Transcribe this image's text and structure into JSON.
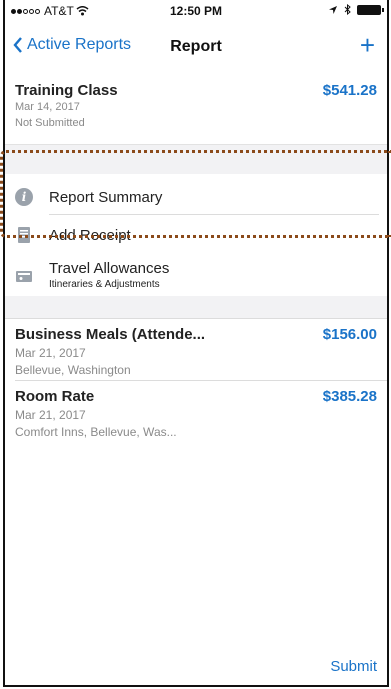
{
  "status_bar": {
    "carrier": "AT&T",
    "time": "12:50 PM"
  },
  "nav": {
    "back_label": "Active Reports",
    "title": "Report",
    "add_label": "+"
  },
  "report": {
    "name": "Training Class",
    "date": "Mar 14, 2017",
    "status": "Not Submitted",
    "amount": "$541.28"
  },
  "menu": {
    "items": [
      {
        "label": "Report Summary"
      },
      {
        "label": "Add Receipt"
      },
      {
        "label": "Travel Allowances",
        "sublabel": "Itineraries & Adjustments"
      }
    ]
  },
  "entries": [
    {
      "name": "Business Meals (Attende...",
      "date": "Mar 21, 2017",
      "location": "Bellevue, Washington",
      "amount": "$156.00"
    },
    {
      "name": "Room Rate",
      "date": "Mar 21, 2017",
      "location": "Comfort Inns, Bellevue, Was...",
      "amount": "$385.28"
    }
  ],
  "footer": {
    "submit_label": "Submit"
  },
  "colors": {
    "accent": "#1a73c8",
    "highlight": "#8b4a1a"
  }
}
